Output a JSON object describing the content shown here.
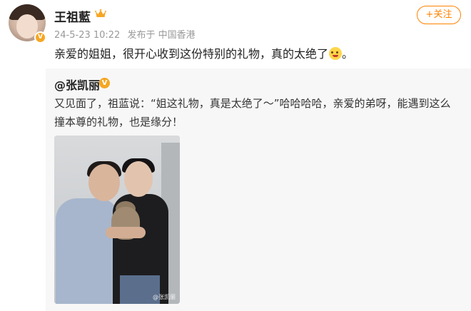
{
  "author": {
    "name": "王祖藍",
    "date": "24-5-23 10:22",
    "source": "发布于 中国香港"
  },
  "follow_button": {
    "label": "+关注"
  },
  "post": {
    "text": "亲爱的姐姐，很开心收到这份特别的礼物，真的太绝了",
    "emoji": "laughing-emoji",
    "suffix": "。"
  },
  "repost": {
    "user": "@张凯丽",
    "text": "又见面了，祖蓝说：“姐这礼物，真是太绝了～”哈哈哈哈，亲爱的弟呀，能遇到这么撞本尊的礼物，也是缘分！",
    "photo": {
      "watermark": "@张凯丽"
    }
  },
  "colors": {
    "accent": "#ff8200",
    "verified": "#f6a623",
    "repost_bg": "#f7f7f7"
  },
  "icons": [
    "crown-icon",
    "verified-icon",
    "laughing-emoji"
  ]
}
